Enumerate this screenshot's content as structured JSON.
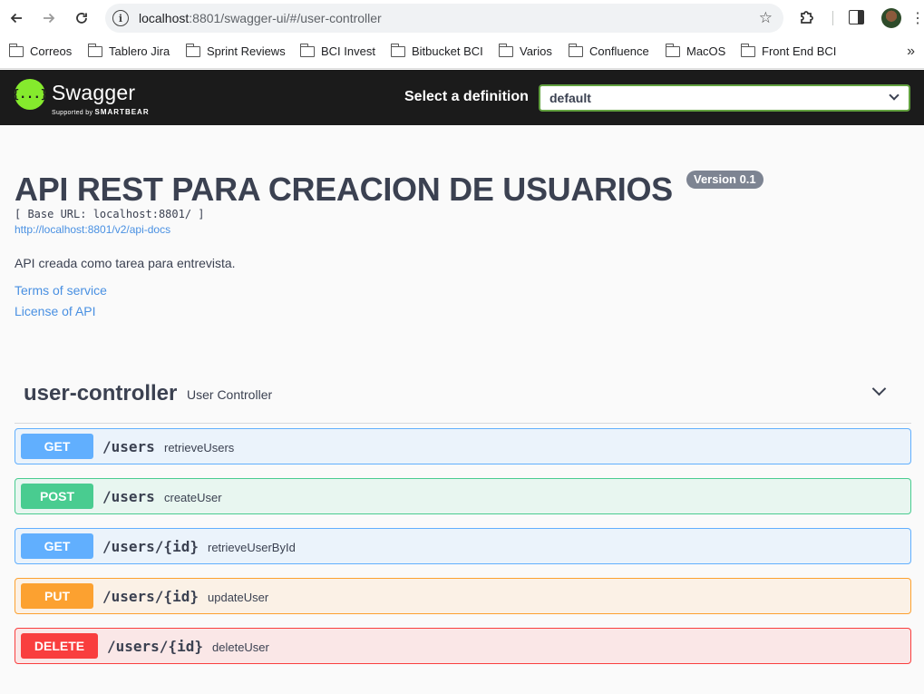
{
  "browser": {
    "url_host": "localhost",
    "url_rest": ":8801/swagger-ui/#/user-controller",
    "info_glyph": "i",
    "bookmarks": [
      "Correos",
      "Tablero Jira",
      "Sprint Reviews",
      "BCI Invest",
      "Bitbucket BCI",
      "Varios",
      "Confluence",
      "MacOS",
      "Front End BCI"
    ]
  },
  "swagger": {
    "brand": "Swagger",
    "supported_by": "Supported by",
    "smartbear": "SMARTBEAR",
    "logo_glyph": "{...}",
    "definition_label": "Select a definition",
    "definition_value": "default"
  },
  "info": {
    "title": "API REST PARA CREACION DE USUARIOS",
    "version": "Version 0.1",
    "base_url": "[ Base URL: localhost:8801/ ]",
    "docs_link": "http://localhost:8801/v2/api-docs",
    "description": "API creada como tarea para entrevista.",
    "terms": "Terms of service",
    "license": "License of API"
  },
  "tag": {
    "name": "user-controller",
    "description": "User Controller"
  },
  "operations": [
    {
      "method": "GET",
      "path": "/users",
      "summary": "retrieveUsers"
    },
    {
      "method": "POST",
      "path": "/users",
      "summary": "createUser"
    },
    {
      "method": "GET",
      "path": "/users/{id}",
      "summary": "retrieveUserById"
    },
    {
      "method": "PUT",
      "path": "/users/{id}",
      "summary": "updateUser"
    },
    {
      "method": "DELETE",
      "path": "/users/{id}",
      "summary": "deleteUser"
    }
  ],
  "colors": {
    "get": "#61affe",
    "post": "#49cc90",
    "put": "#fca130",
    "delete": "#f93e3e",
    "swagger_green": "#85ea2d",
    "link": "#4990e2"
  }
}
